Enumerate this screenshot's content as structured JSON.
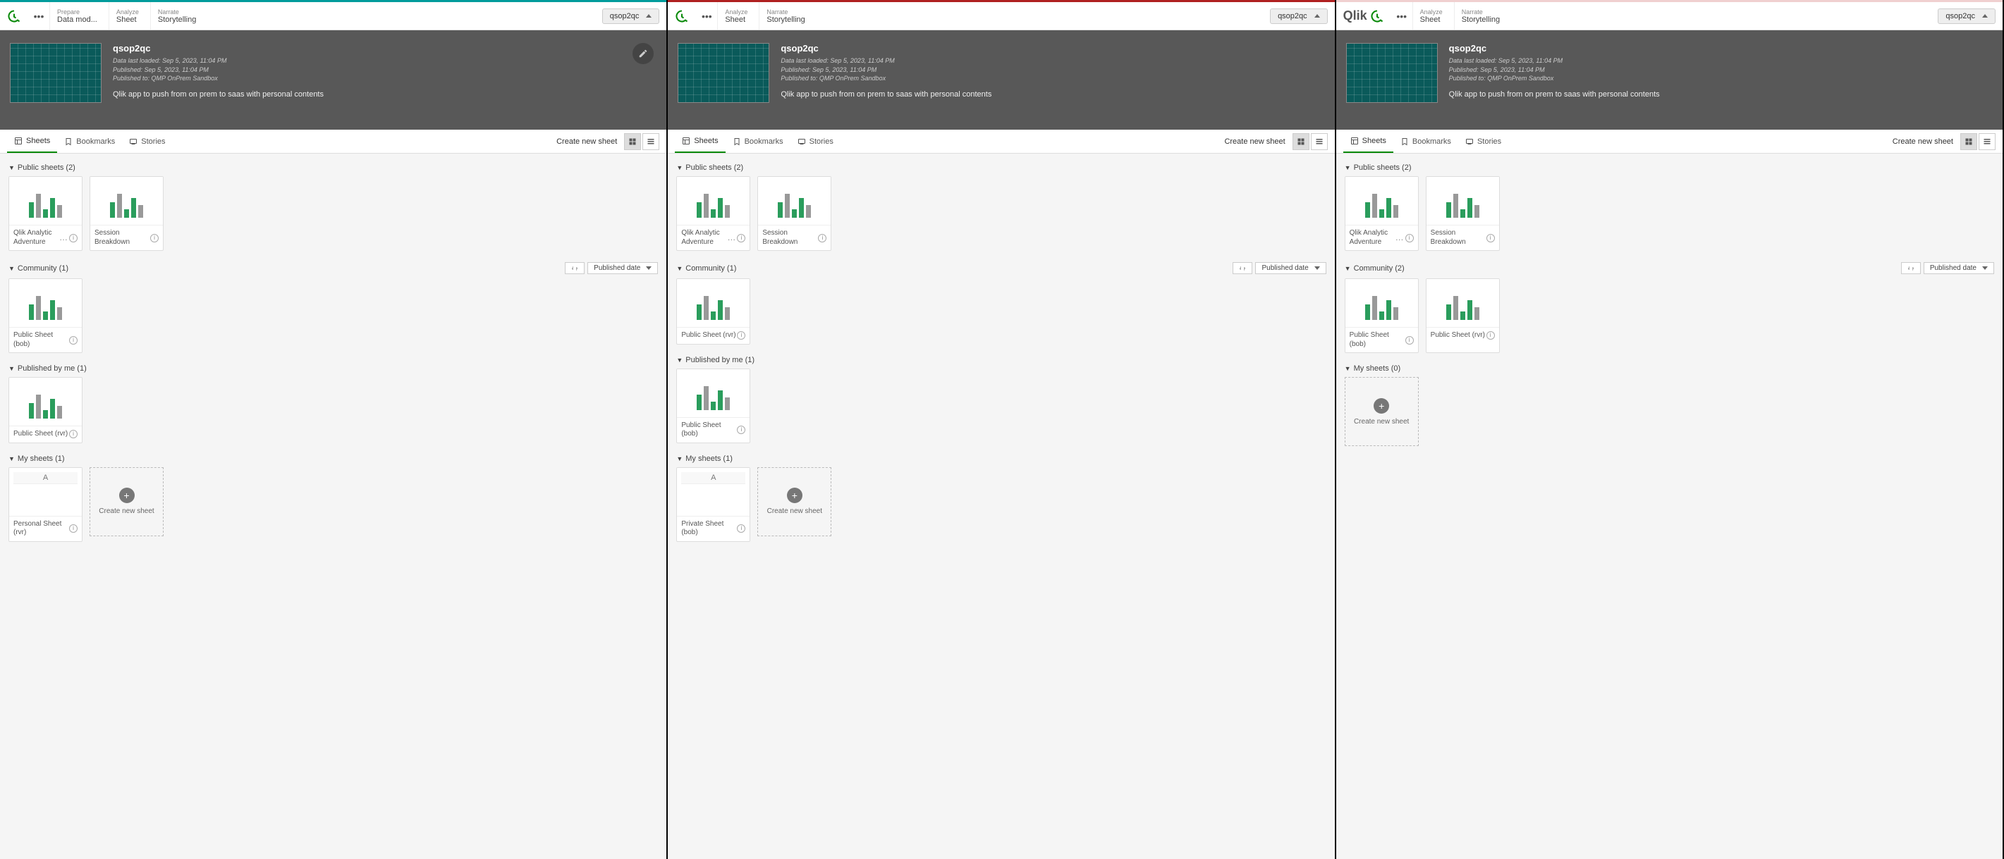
{
  "app": {
    "name": "qsop2qc",
    "data_last_loaded": "Data last loaded: Sep 5, 2023, 11:04 PM",
    "published": "Published: Sep 5, 2023, 11:04 PM",
    "published_to": "Published to: QMP OnPrem Sandbox",
    "description": "Qlik app to push from on prem to saas with personal contents"
  },
  "nav": {
    "prepare": {
      "label": "Prepare",
      "sub": "Data mod..."
    },
    "analyze": {
      "label": "Analyze",
      "sub": "Sheet"
    },
    "narrate": {
      "label": "Narrate",
      "sub": "Storytelling"
    }
  },
  "tabs": {
    "sheets": "Sheets",
    "bookmarks": "Bookmarks",
    "stories": "Stories",
    "create": "Create new sheet"
  },
  "sort": {
    "published_date": "Published date"
  },
  "create_new": "Create new sheet",
  "brand": "Qlik",
  "panels": [
    {
      "sections": [
        {
          "title": "Public sheets (2)",
          "cards": [
            {
              "label": "Qlik Analytic Adventure",
              "trailing": "dots"
            },
            {
              "label": "Session Breakdown",
              "trailing": "info"
            }
          ]
        },
        {
          "title": "Community (1)",
          "tools": true,
          "cards": [
            {
              "label": "Public Sheet (bob)",
              "trailing": "info"
            }
          ]
        },
        {
          "title": "Published by me (1)",
          "cards": [
            {
              "label": "Public Sheet (rvr)",
              "trailing": "info"
            }
          ]
        },
        {
          "title": "My sheets (1)",
          "cards": [
            {
              "label": "Personal Sheet (rvr)",
              "trailing": "info",
              "personal": true
            }
          ],
          "create": true
        }
      ]
    },
    {
      "sections": [
        {
          "title": "Public sheets (2)",
          "cards": [
            {
              "label": "Qlik Analytic Adventure",
              "trailing": "dots"
            },
            {
              "label": "Session Breakdown",
              "trailing": "info"
            }
          ]
        },
        {
          "title": "Community (1)",
          "tools": true,
          "cards": [
            {
              "label": "Public Sheet (rvr)",
              "trailing": "info"
            }
          ]
        },
        {
          "title": "Published by me (1)",
          "cards": [
            {
              "label": "Public Sheet (bob)",
              "trailing": "info"
            }
          ]
        },
        {
          "title": "My sheets (1)",
          "cards": [
            {
              "label": "Private Sheet (bob)",
              "trailing": "info",
              "personal": true
            }
          ],
          "create": true
        }
      ]
    },
    {
      "sections": [
        {
          "title": "Public sheets (2)",
          "cards": [
            {
              "label": "Qlik Analytic Adventure",
              "trailing": "dots"
            },
            {
              "label": "Session Breakdown",
              "trailing": "info"
            }
          ]
        },
        {
          "title": "Community (2)",
          "tools": true,
          "cards": [
            {
              "label": "Public Sheet (bob)",
              "trailing": "info"
            },
            {
              "label": "Public Sheet (rvr)",
              "trailing": "info"
            }
          ]
        },
        {
          "title": "My sheets (0)",
          "cards": [],
          "create": true
        }
      ]
    }
  ]
}
